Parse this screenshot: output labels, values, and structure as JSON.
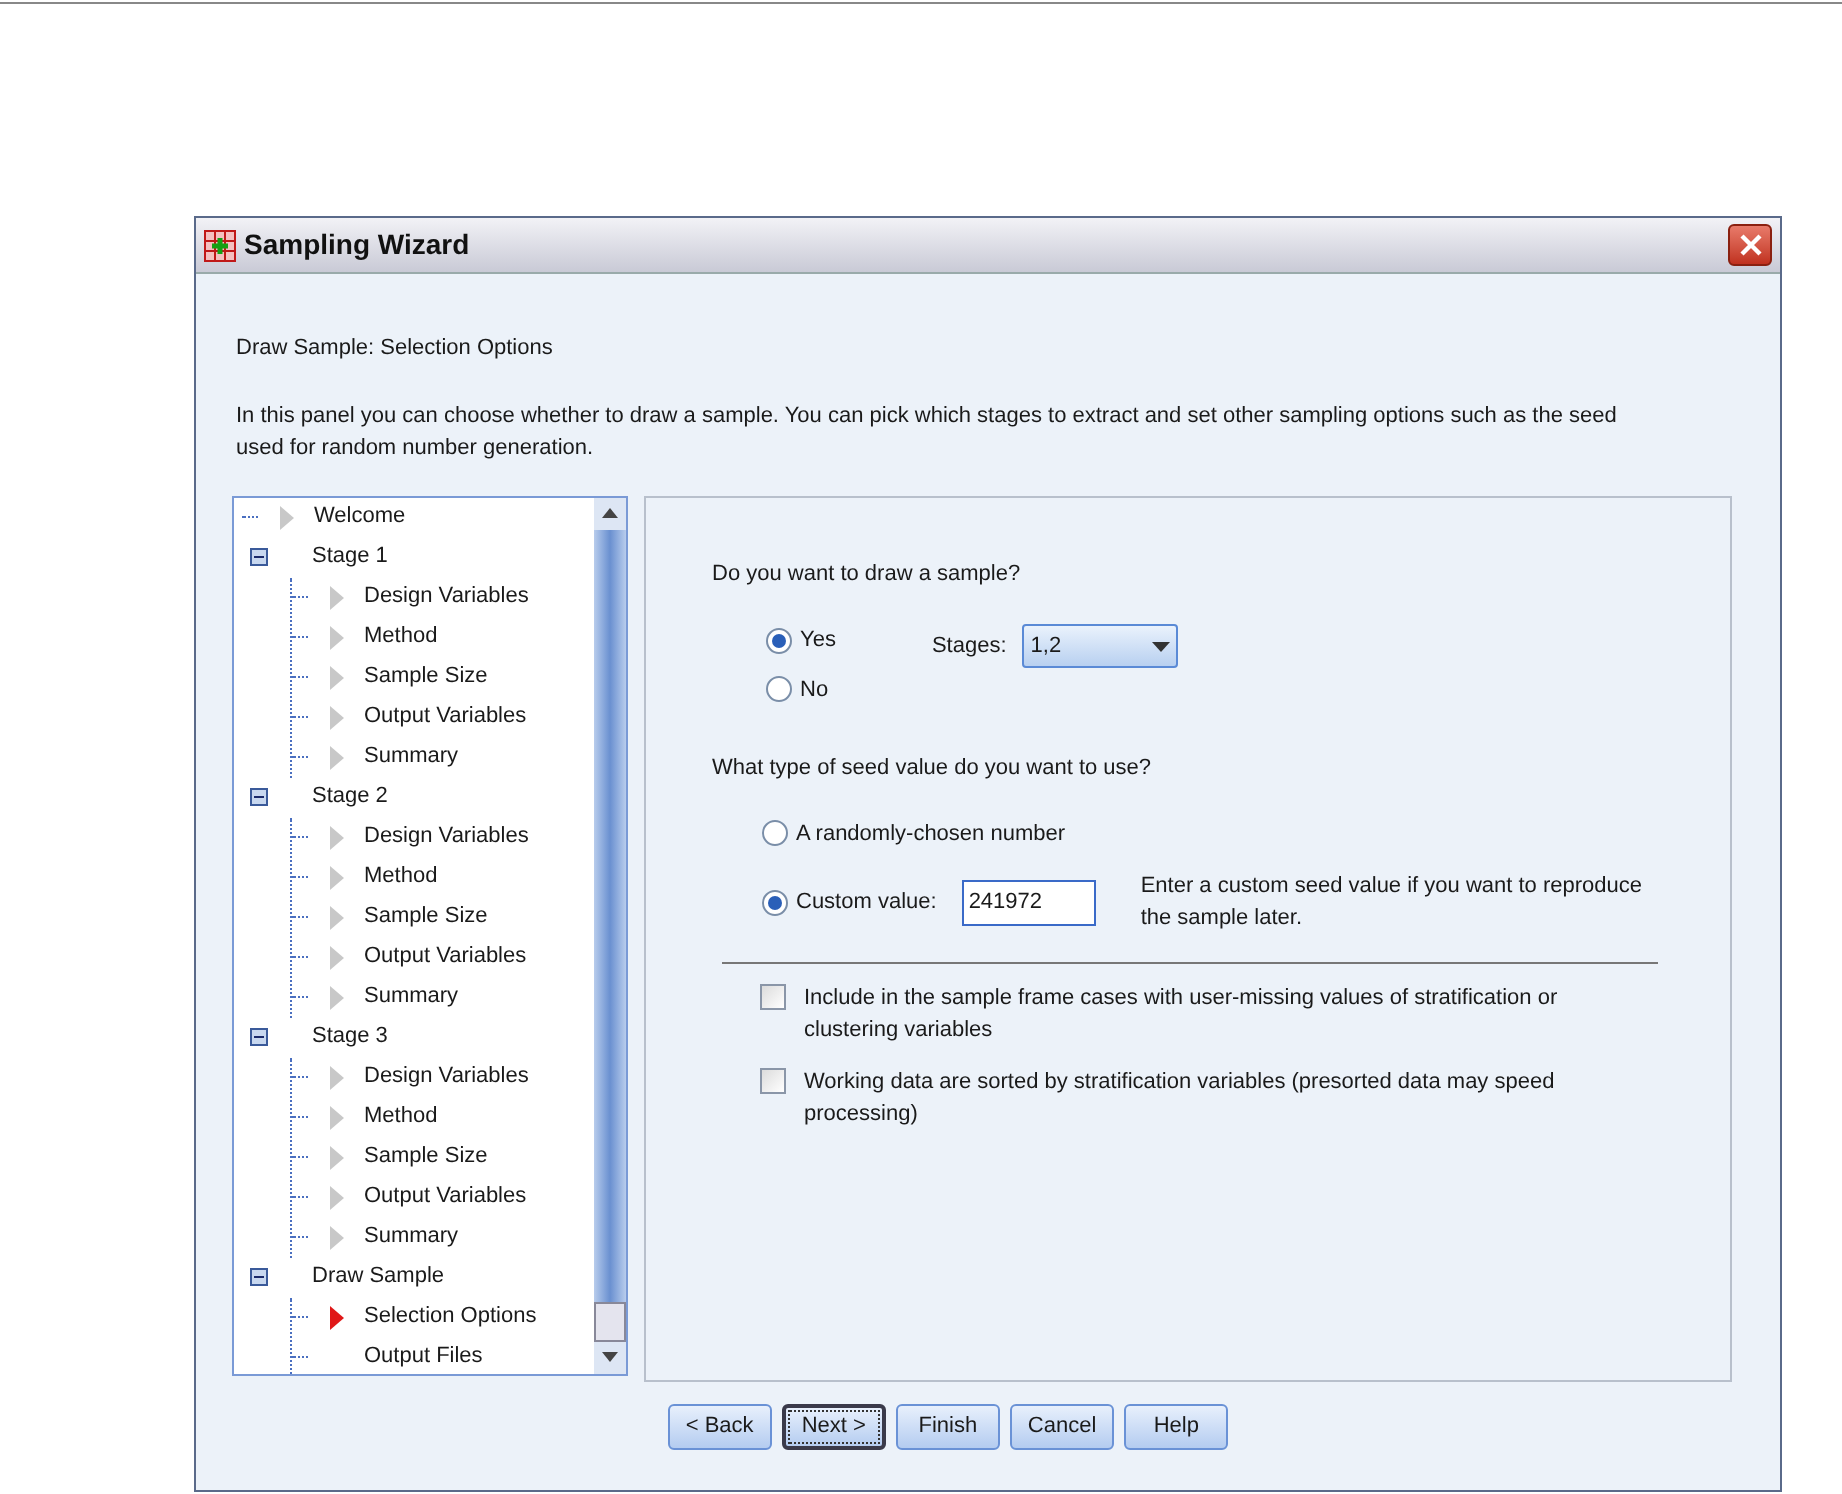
{
  "window": {
    "title": "Sampling Wizard"
  },
  "header": {
    "title": "Draw Sample: Selection Options",
    "description": "In this panel you can choose whether to draw  a sample. You can pick which stages to extract and set other sampling options such as the seed used for random number generation."
  },
  "tree": [
    {
      "label": "Welcome",
      "arrow": true,
      "selected": false
    },
    {
      "label": "Stage 1",
      "expanded": true,
      "children": [
        {
          "label": "Design Variables",
          "arrow": true,
          "selected": false
        },
        {
          "label": "Method",
          "arrow": true,
          "selected": false
        },
        {
          "label": "Sample Size",
          "arrow": true,
          "selected": false
        },
        {
          "label": "Output Variables",
          "arrow": true,
          "selected": false
        },
        {
          "label": "Summary",
          "arrow": true,
          "selected": false
        }
      ]
    },
    {
      "label": "Stage 2",
      "expanded": true,
      "children": [
        {
          "label": "Design Variables",
          "arrow": true,
          "selected": false
        },
        {
          "label": "Method",
          "arrow": true,
          "selected": false
        },
        {
          "label": "Sample Size",
          "arrow": true,
          "selected": false
        },
        {
          "label": "Output Variables",
          "arrow": true,
          "selected": false
        },
        {
          "label": "Summary",
          "arrow": true,
          "selected": false
        }
      ]
    },
    {
      "label": "Stage 3",
      "expanded": true,
      "children": [
        {
          "label": "Design Variables",
          "arrow": true,
          "selected": false
        },
        {
          "label": "Method",
          "arrow": true,
          "selected": false
        },
        {
          "label": "Sample Size",
          "arrow": true,
          "selected": false
        },
        {
          "label": "Output Variables",
          "arrow": true,
          "selected": false
        },
        {
          "label": "Summary",
          "arrow": true,
          "selected": false
        }
      ]
    },
    {
      "label": "Draw Sample",
      "expanded": true,
      "children": [
        {
          "label": "Selection Options",
          "arrow": true,
          "selected": true
        },
        {
          "label": "Output Files",
          "arrow": false,
          "selected": false
        }
      ]
    }
  ],
  "draw_question": {
    "label": "Do you want to draw a sample?",
    "options": [
      {
        "label": "Yes",
        "selected": true
      },
      {
        "label": "No",
        "selected": false
      }
    ],
    "stages": {
      "label": "Stages:",
      "value": "1,2"
    }
  },
  "seed_question": {
    "label": "What type of seed value do you want to use?",
    "options": [
      {
        "label": "A randomly-chosen number",
        "selected": false
      },
      {
        "label": "Custom value:",
        "selected": true
      }
    ],
    "custom_value": "241972",
    "hint": "Enter a custom seed value if you want to reproduce the sample later."
  },
  "checkboxes": [
    {
      "label": "Include in the sample frame cases with user-missing values of stratification or clustering variables",
      "checked": false
    },
    {
      "label": "Working data are sorted by stratification variables (presorted data may speed processing)",
      "checked": false
    }
  ],
  "buttons": [
    {
      "label": "< Back",
      "focused": false
    },
    {
      "label": "Next >",
      "focused": true
    },
    {
      "label": "Finish",
      "focused": false
    },
    {
      "label": "Cancel",
      "focused": false
    },
    {
      "label": "Help",
      "focused": false
    }
  ]
}
